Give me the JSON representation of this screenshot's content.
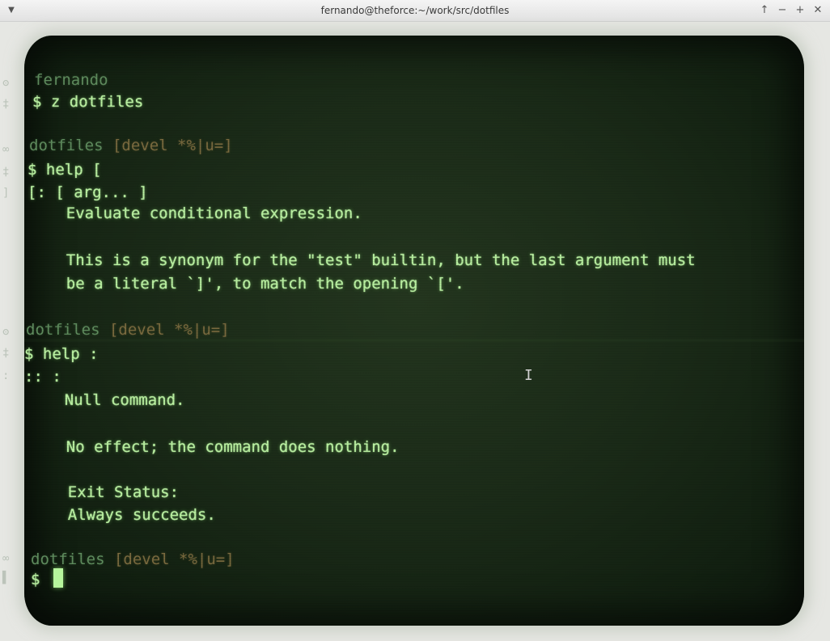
{
  "window": {
    "title": "fernando@theforce:~/work/src/dotfiles",
    "menu_icon": "chevron-down-icon",
    "controls": {
      "up": "↑",
      "minimize": "−",
      "maximize": "+",
      "close": "✕"
    }
  },
  "terminal": {
    "lines": [
      {
        "text": "fernando",
        "style": "dim"
      },
      {
        "text": "$ z dotfiles",
        "style": "normal"
      },
      {
        "prompt_dir": "dotfiles",
        "prompt_branch": "[devel *%|u=]"
      },
      {
        "text": "$ help [",
        "style": "normal"
      },
      {
        "text": "[: [ arg... ]",
        "style": "normal"
      },
      {
        "text": "    Evaluate conditional expression.",
        "style": "normal"
      },
      {
        "text": "    This is a synonym for the \"test\" builtin, but the last argument must",
        "style": "normal"
      },
      {
        "text": "    be a literal `]', to match the opening `['.",
        "style": "normal"
      },
      {
        "prompt_dir": "dotfiles",
        "prompt_branch": "[devel *%|u=]"
      },
      {
        "text": "$ help :",
        "style": "normal"
      },
      {
        "text": ":: :",
        "style": "normal"
      },
      {
        "text": "    Null command.",
        "style": "normal"
      },
      {
        "text": "    No effect; the command does nothing.",
        "style": "normal"
      },
      {
        "text": "    Exit Status:",
        "style": "normal"
      },
      {
        "text": "    Always succeeds.",
        "style": "normal"
      },
      {
        "prompt_dir": "dotfiles",
        "prompt_branch": "[devel *%|u=]"
      },
      {
        "text": "$ ",
        "style": "normal"
      }
    ]
  },
  "colors": {
    "phosphor": "#b9f0a0",
    "dim": "#5f8c5e",
    "branch": "#7a6a3f",
    "screen": "#1b2b18"
  }
}
